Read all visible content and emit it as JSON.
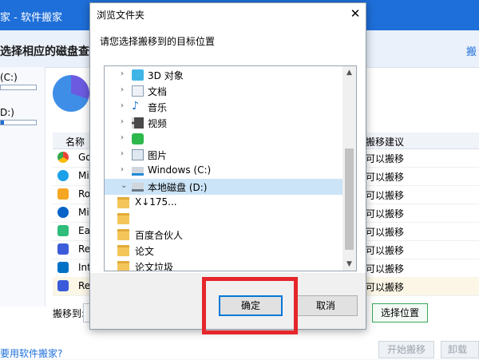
{
  "app": {
    "title": "家 - 软件搬家",
    "prompt": "选择相应的磁盘查看",
    "right_link": "搬",
    "drives": [
      {
        "label": "(C:)",
        "usage": 0.0
      },
      {
        "label": "D:)",
        "usage": 0.08
      }
    ],
    "table": {
      "col_name": "名称",
      "col_suggest": "搬移建议",
      "rows": [
        {
          "name": "Go",
          "suggest": "可以搬移",
          "icon": "chrome-icon"
        },
        {
          "name": "Mi",
          "suggest": "可以搬移",
          "icon": "edge-icon"
        },
        {
          "name": "Ro",
          "suggest": "可以搬移",
          "icon": "roblox-icon"
        },
        {
          "name": "Mi",
          "suggest": "可以搬移",
          "icon": "onedrive-icon"
        },
        {
          "name": "Ea",
          "suggest": "可以搬移",
          "icon": "easeus-icon"
        },
        {
          "name": "Re",
          "suggest": "可以搬移",
          "icon": "app-icon"
        },
        {
          "name": "Int",
          "suggest": "可以搬移",
          "icon": "intel-icon"
        },
        {
          "name": "Re",
          "suggest": "可以搬移",
          "icon": "app-icon"
        }
      ]
    },
    "move_to_label": "搬移到:",
    "choose_location": "选择位置",
    "help_link": "要用软件搬家?",
    "start_move": "开始搬移",
    "uninstall": "卸载"
  },
  "dialog": {
    "title": "浏览文件夹",
    "instruction": "请您选择搬移到的目标位置",
    "close_glyph": "✕",
    "tree": [
      {
        "label": "3D 对象",
        "icon": "3d-objects-icon",
        "level": 1
      },
      {
        "label": "文档",
        "icon": "documents-icon",
        "level": 1
      },
      {
        "label": "音乐",
        "icon": "music-icon",
        "level": 1
      },
      {
        "label": "视频",
        "icon": "videos-icon",
        "level": 1
      },
      {
        "label": "",
        "icon": "green-app-icon",
        "level": 1
      },
      {
        "label": "图片",
        "icon": "pictures-icon",
        "level": 1
      },
      {
        "label": "Windows (C:)",
        "icon": "windows-drive-icon",
        "level": 1
      },
      {
        "label": "本地磁盘 (D:)",
        "icon": "local-disk-icon",
        "level": 1,
        "selected": true
      },
      {
        "label": "X↓175...",
        "icon": "folder-icon",
        "level": 2
      },
      {
        "label": "",
        "icon": "folder-icon",
        "level": 2
      },
      {
        "label": "百度合伙人",
        "icon": "folder-icon",
        "level": 2
      },
      {
        "label": "论文",
        "icon": "folder-icon",
        "level": 2
      },
      {
        "label": "论文垃圾",
        "icon": "folder-icon",
        "level": 2
      }
    ],
    "ok": "确定",
    "cancel": "取消"
  },
  "colors": {
    "accent": "#1e6fd9",
    "highlight": "#e5262b",
    "selection": "#cce4f7"
  }
}
